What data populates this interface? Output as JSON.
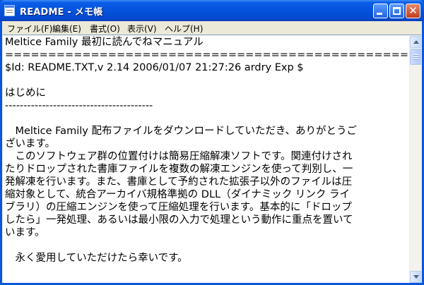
{
  "window": {
    "title": "README - メモ帳",
    "icon": "notepad-icon",
    "buttons": [
      "minimize-icon",
      "maximize-icon",
      "close-icon"
    ],
    "titlebar_color": "#0552db",
    "close_color": "#c33c1c"
  },
  "menu": [
    {
      "label": "ファイル(F)"
    },
    {
      "label": "編集(E)"
    },
    {
      "label": "書式(O)"
    },
    {
      "label": "表示(V)"
    },
    {
      "label": "ヘルプ(H)"
    }
  ],
  "document": {
    "heading": "Meltice Family 最初に読んでねマニュアル",
    "rule1": "============================================================",
    "id_line": "$Id: README.TXT,v 2.14 2006/01/07 21:27:26 ardry Exp $",
    "section_title": "はじめに",
    "rule2": "----------------------------------------",
    "para1_l1": "　Meltice Family 配布ファイルをダウンロードしていただき、ありがとうご",
    "para1_l2": "ざいます。",
    "para2_l1": "　このソフトウェア群の位置付けは簡易圧縮解凍ソフトです。関連付けされ",
    "para2_l2": "たりドロップされた書庫ファイルを複数の解凍エンジンを使って判別し、一",
    "para2_l3": "発解凍を行います。また、書庫として予約された拡張子以外のファイルは圧",
    "para2_l4": "縮対象として、統合アーカイバ規格準拠の DLL（ダイナミック リンク ライ",
    "para2_l5": "ブラリ）の圧縮エンジンを使って圧縮処理を行います。基本的に「ドロップ",
    "para2_l6": "したら」一発処理、あるいは最小限の入力で処理という動作に重点を置いて",
    "para2_l7": "います。",
    "para3": "　永く愛用していただけたら幸いです。"
  },
  "scrollbar": {
    "up": "scroll-up-arrow-icon",
    "down": "scroll-down-arrow-icon"
  }
}
